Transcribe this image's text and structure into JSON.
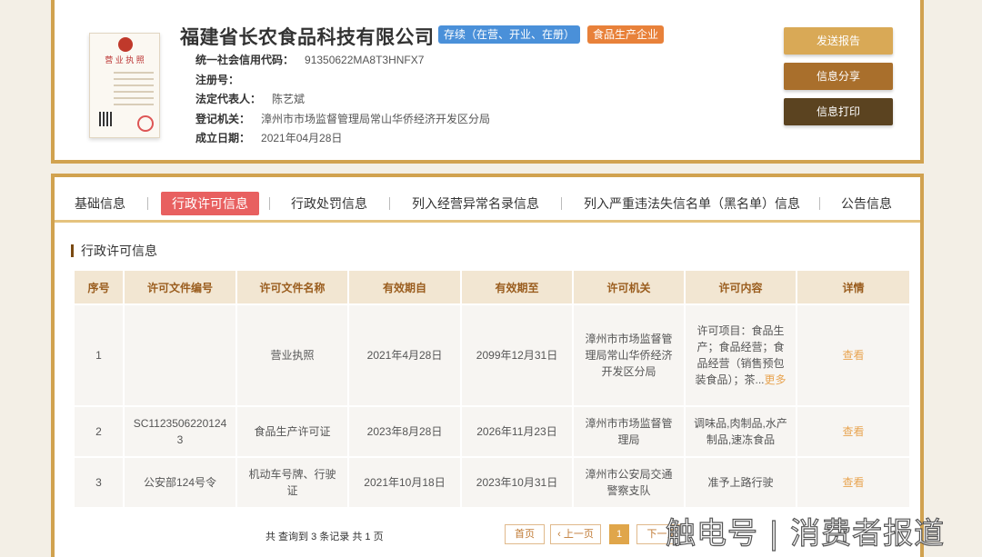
{
  "company": {
    "name": "福建省长农食品科技有限公司",
    "status_tag": "存续（在营、开业、在册）",
    "type_tag": "食品生产企业",
    "license_image_title": "营 业 执 照",
    "fields": [
      {
        "label": "统一社会信用代码：",
        "value": "91350622MA8T3HNFX7"
      },
      {
        "label": "注册号：",
        "value": ""
      },
      {
        "label": "法定代表人：",
        "value": "陈艺斌"
      },
      {
        "label": "登记机关：",
        "value": "漳州市市场监督管理局常山华侨经济开发区分局"
      },
      {
        "label": "成立日期：",
        "value": "2021年04月28日"
      }
    ]
  },
  "actions": {
    "report": "发送报告",
    "share": "信息分享",
    "print": "信息打印"
  },
  "tabs": [
    "基础信息",
    "行政许可信息",
    "行政处罚信息",
    "列入经营异常名录信息",
    "列入严重违法失信名单（黑名单）信息",
    "公告信息"
  ],
  "section_title": "行政许可信息",
  "table": {
    "headers": [
      "序号",
      "许可文件编号",
      "许可文件名称",
      "有效期自",
      "有效期至",
      "许可机关",
      "许可内容",
      "详情"
    ],
    "rows": [
      {
        "no": "1",
        "doc_no": "",
        "doc_name": "营业执照",
        "from": "2021年4月28日",
        "to": "2099年12月31日",
        "authority": "漳州市市场监督管理局常山华侨经济开发区分局",
        "content": "许可项目：食品生产；食品经营；食品经营（销售预包装食品）；茶...",
        "more": "更多",
        "detail": "查看"
      },
      {
        "no": "2",
        "doc_no": "SC11235062201243",
        "doc_name": "食品生产许可证",
        "from": "2023年8月28日",
        "to": "2026年11月23日",
        "authority": "漳州市市场监督管理局",
        "content": "调味品,肉制品,水产制品,速冻食品",
        "more": "",
        "detail": "查看"
      },
      {
        "no": "3",
        "doc_no": "公安部124号令",
        "doc_name": "机动车号牌、行驶证",
        "from": "2021年10月18日",
        "to": "2023年10月31日",
        "authority": "漳州市公安局交通警察支队",
        "content": "准予上路行驶",
        "more": "",
        "detail": "查看"
      }
    ]
  },
  "pagination": {
    "summary": "共 查询到 3 条记录 共 1 页",
    "first": "首页",
    "prev": "‹ 上一页",
    "current": "1",
    "next": "下一页"
  },
  "watermark": "触电号 | 消费者报道"
}
